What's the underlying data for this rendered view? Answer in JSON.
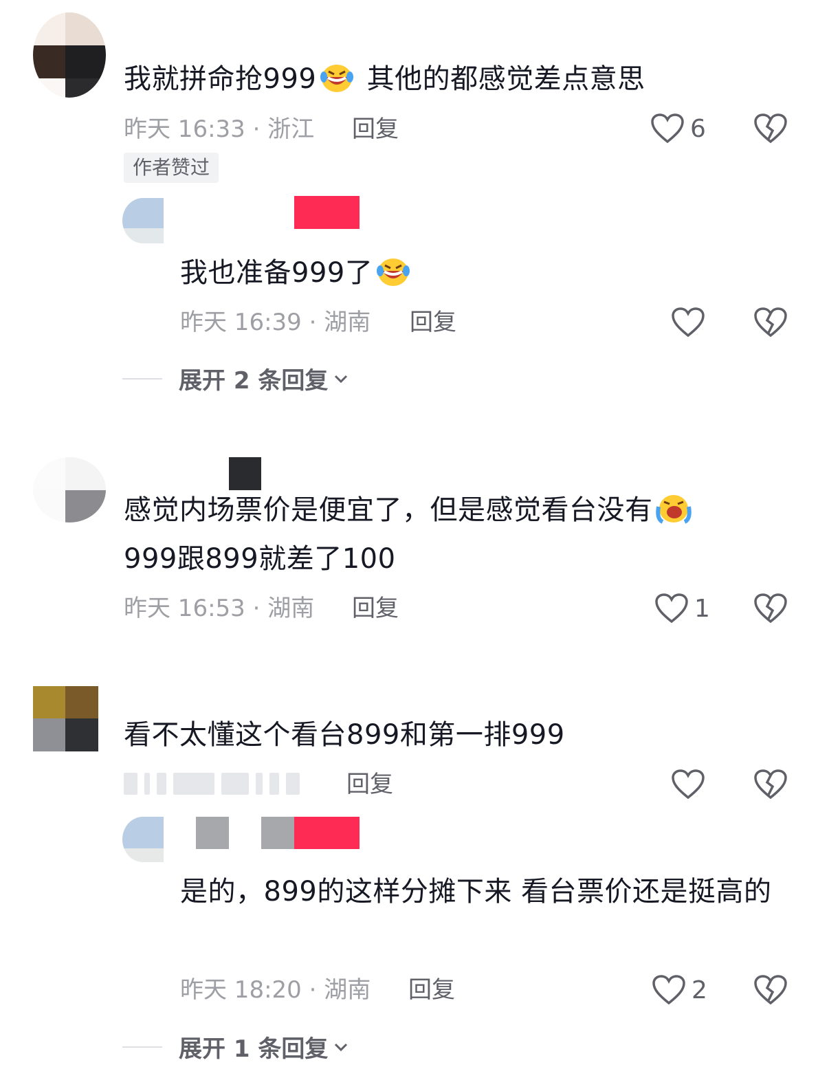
{
  "colors": {
    "text": "#161823",
    "meta": "#9e9fa4",
    "action": "#5f6068",
    "accent": "#fe2c55"
  },
  "comments": [
    {
      "text_before_emoji": "我就拼命抢999",
      "emoji": "laughing-tears",
      "text_after_emoji": " 其他的都感觉差点意思",
      "meta": "昨天 16:33 · 浙江",
      "reply_label": "回复",
      "like_count": "6",
      "badge": "作者赞过",
      "reply": {
        "text": "我也准备999了",
        "emoji": "laughing-tears",
        "meta": "昨天 16:39 · 湖南",
        "reply_label": "回复",
        "like_count": ""
      },
      "expand_label": "展开 2 条回复"
    },
    {
      "line1": "感觉内场票价是便宜了，但是感觉看台没有",
      "emoji": "loud-crying",
      "line2": "999跟899就差了100",
      "meta": "昨天 16:53 · 湖南",
      "reply_label": "回复",
      "like_count": "1"
    },
    {
      "text": "看不太懂这个看台899和第一排999",
      "reply_label": "回复",
      "like_count": "",
      "reply": {
        "text": "是的，899的这样分摊下来 看台票价还是挺高的",
        "meta": "昨天 18:20 · 湖南",
        "reply_label": "回复",
        "like_count": "2"
      },
      "expand_label": "展开 1 条回复"
    }
  ]
}
